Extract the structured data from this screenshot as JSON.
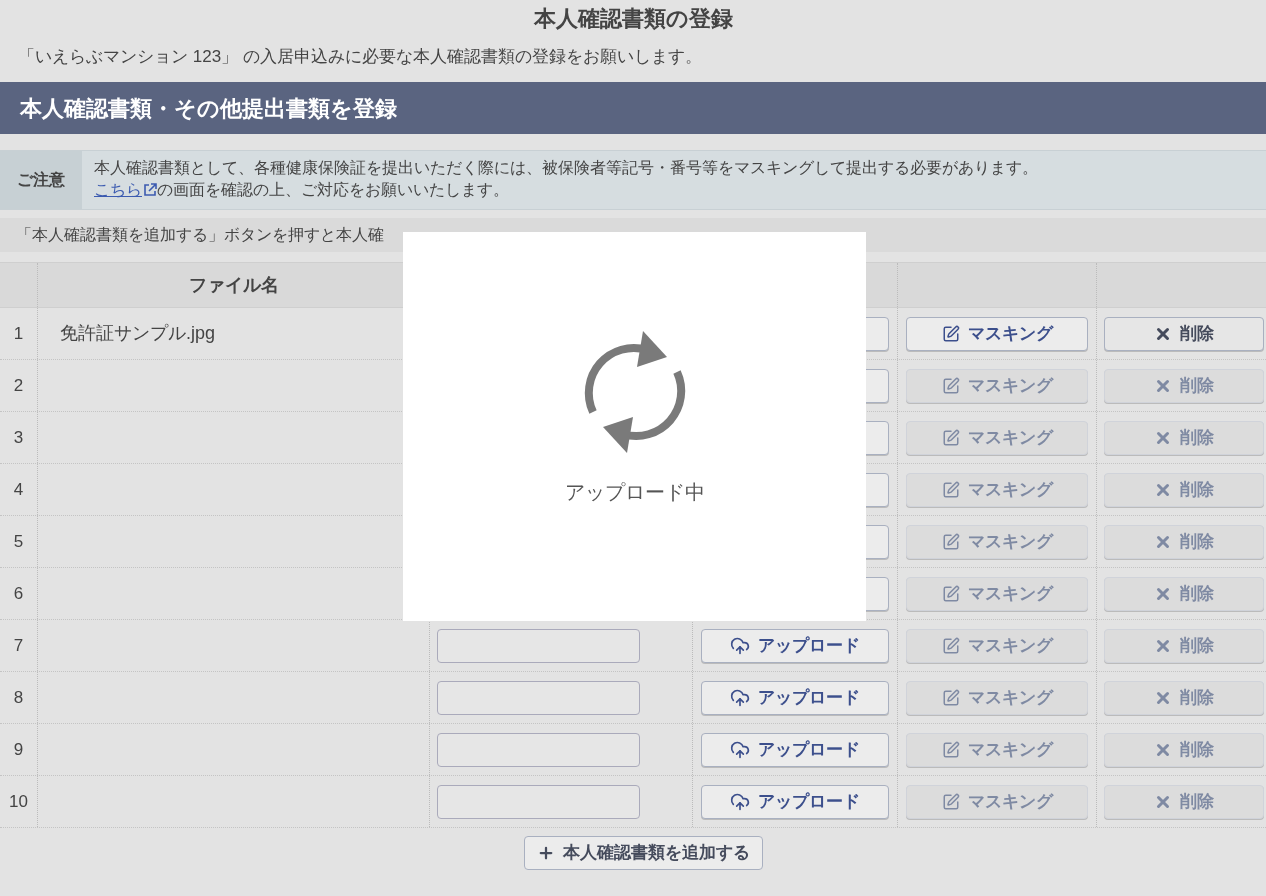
{
  "page": {
    "title": "本人確認書類の登録",
    "intro": "「いえらぶマンション 123」 の入居申込みに必要な本人確認書類の登録をお願いします。"
  },
  "section": {
    "title": "本人確認書類・その他提出書類を登録"
  },
  "notice": {
    "label": "ご注意",
    "line_1": "本人確認書類として、各種健康保険証を提出いただく際には、被保険者等記号・番号等をマスキングして提出する必要があります。",
    "link": "こちら",
    "line_2": "の画面を確認の上、ご対応をお願いいたします。"
  },
  "hint": "「本人確認書類を追加する」ボタンを押すと本人確",
  "table": {
    "columns": [
      "ファイル名"
    ],
    "rows": [
      {
        "number": "1",
        "file_name": "免許証サンプル.jpg",
        "masking": {
          "label": "マスキング",
          "disabled": false
        },
        "delete": {
          "label": "削除",
          "disabled": false
        }
      },
      {
        "number": "2",
        "masking": {
          "label": "マスキング",
          "disabled": true
        },
        "delete": {
          "label": "削除",
          "disabled": true
        }
      },
      {
        "number": "3",
        "masking": {
          "label": "マスキング",
          "disabled": true
        },
        "delete": {
          "label": "削除",
          "disabled": true
        }
      },
      {
        "number": "4",
        "masking": {
          "label": "マスキング",
          "disabled": true
        },
        "delete": {
          "label": "削除",
          "disabled": true
        }
      },
      {
        "number": "5",
        "masking": {
          "label": "マスキング",
          "disabled": true
        },
        "delete": {
          "label": "削除",
          "disabled": true
        }
      },
      {
        "number": "6",
        "masking": {
          "label": "マスキング",
          "disabled": true
        },
        "delete": {
          "label": "削除",
          "disabled": true
        }
      },
      {
        "number": "7",
        "upload": "アップロード",
        "masking": {
          "label": "マスキング",
          "disabled": true
        },
        "delete": {
          "label": "削除",
          "disabled": true
        }
      },
      {
        "number": "8",
        "upload": "アップロード",
        "masking": {
          "label": "マスキング",
          "disabled": true
        },
        "delete": {
          "label": "削除",
          "disabled": true
        }
      },
      {
        "number": "9",
        "upload": "アップロード",
        "masking": {
          "label": "マスキング",
          "disabled": true
        },
        "delete": {
          "label": "削除",
          "disabled": true
        }
      },
      {
        "number": "10",
        "upload": "アップロード",
        "masking": {
          "label": "マスキング",
          "disabled": true
        },
        "delete": {
          "label": "削除",
          "disabled": true
        }
      }
    ]
  },
  "add_button": "本人確認書類を追加する",
  "modal": {
    "message": "アップロード中"
  }
}
